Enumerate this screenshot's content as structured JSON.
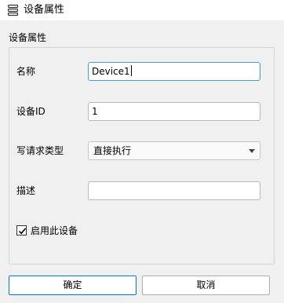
{
  "window": {
    "title": "设备属性",
    "icon": "layers-icon"
  },
  "group": {
    "title": "设备属性"
  },
  "fields": {
    "name": {
      "label": "名称",
      "value": "Device1"
    },
    "device_id": {
      "label": "设备ID",
      "value": "1"
    },
    "write_type": {
      "label": "写请求类型",
      "selected": "直接执行"
    },
    "description": {
      "label": "描述",
      "value": ""
    }
  },
  "enable": {
    "label": "启用此设备",
    "checked": true
  },
  "buttons": {
    "ok": "确定",
    "cancel": "取消"
  },
  "colors": {
    "focus_border": "#4b9bd6",
    "primary_border": "#0078d7"
  }
}
